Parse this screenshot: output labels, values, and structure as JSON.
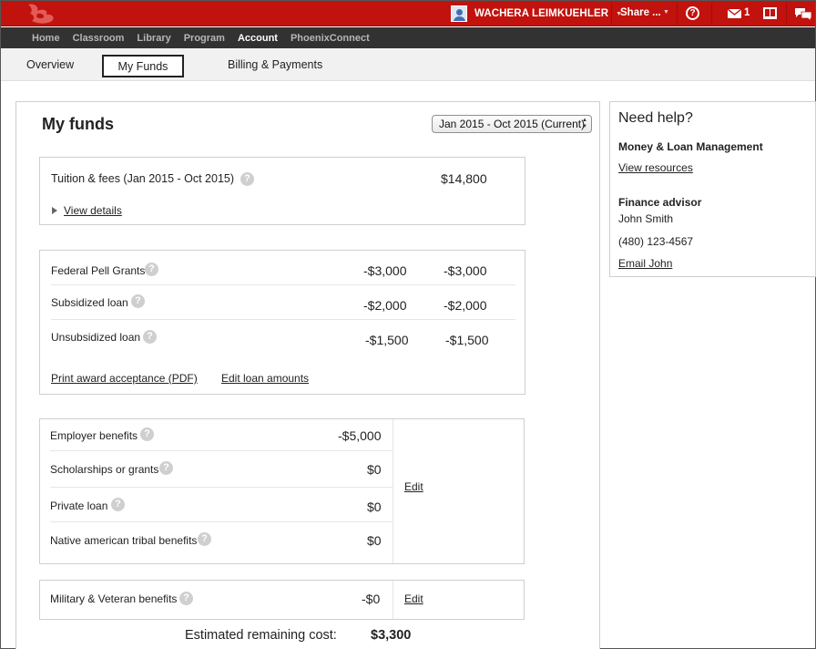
{
  "topbar": {
    "user_name": "WACHERA LEIMKUEHLER",
    "share_label": "Share ...",
    "help_glyph": "?",
    "mail_count": "1",
    "brand_color": "#c1120d"
  },
  "nav": {
    "items": [
      "Home",
      "Classroom",
      "Library",
      "Program",
      "Account",
      "PhoenixConnect"
    ],
    "active": "Account"
  },
  "subnav": {
    "overview": "Overview",
    "my_funds": "My Funds",
    "billing": "Billing & Payments"
  },
  "funds": {
    "title": "My funds",
    "period": "Jan 2015 - Oct 2015 (Current)",
    "tuition": {
      "label": "Tuition & fees (Jan 2015 - Oct 2015)",
      "amount": "$14,800",
      "details_link": "View details"
    },
    "awards": [
      {
        "label": "Federal Pell Grants",
        "amount1": "-$3,000",
        "amount2": "-$3,000"
      },
      {
        "label": "Subsidized loan",
        "amount1": "-$2,000",
        "amount2": "-$2,000"
      },
      {
        "label": "Unsubsidized loan",
        "amount1": "-$1,500",
        "amount2": "-$1,500"
      }
    ],
    "print_link": "Print award acceptance (PDF)",
    "edit_loans_link": "Edit loan amounts",
    "other": [
      {
        "label": "Employer benefits",
        "amount": "-$5,000"
      },
      {
        "label": "Scholarships or grants",
        "amount": "$0"
      },
      {
        "label": "Private loan",
        "amount": "$0"
      },
      {
        "label": "Native american tribal benefits",
        "amount": "$0"
      }
    ],
    "other_edit": "Edit",
    "military": {
      "label": "Military & Veteran benefits",
      "amount": "-$0",
      "edit": "Edit"
    },
    "estimated_label": "Estimated remaining cost:",
    "estimated_value": "$3,300"
  },
  "help": {
    "title": "Need help?",
    "section1_title": "Money & Loan Management",
    "section1_link": "View resources",
    "section2_title": "Finance advisor",
    "advisor_name": "John Smith",
    "advisor_phone": "(480) 123-4567",
    "email_link": "Email John"
  }
}
